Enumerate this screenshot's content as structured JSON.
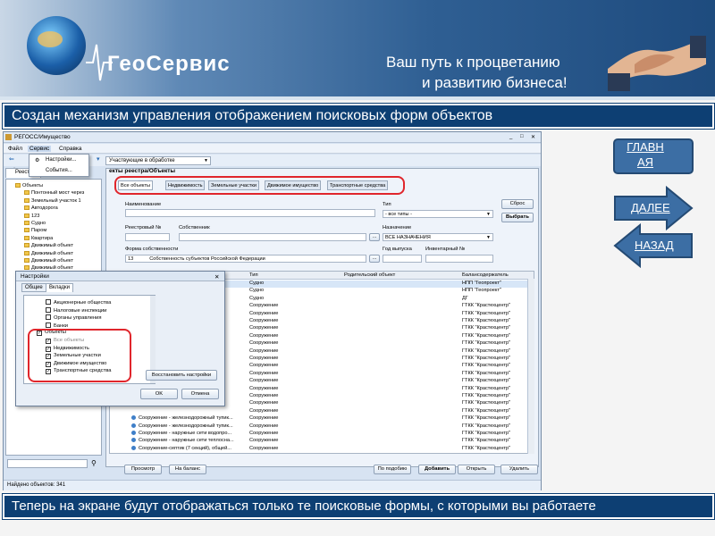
{
  "banner": {
    "logo": "ГеоСервис",
    "slogan_line1": "Ваш путь к процветанию",
    "slogan_line2": "и развитию бизнеса!"
  },
  "top_caption": "Создан механизм управления отображением поисковых форм объектов",
  "bottom_caption": "Теперь на экране будут отображаться только те поисковые формы, с которыми вы работаете",
  "nav": {
    "home": "ГЛАВНАЯ",
    "next": "ДАЛЕЕ",
    "back": "НАЗАД"
  },
  "colors": {
    "caption_bg": "#0d3f73",
    "nav_blue": "#3c6ea4",
    "highlight_red": "#e0262c"
  },
  "window": {
    "title": "РЕГОСС/Имущество",
    "menu": [
      "Файл",
      "Сервис",
      "Справка"
    ],
    "toolbar_combo": "Участвующие в обработке",
    "service_menu": [
      "Настройки...",
      "События..."
    ],
    "registry_tab": "Реестр",
    "registry_title": "екты реестра/Объекты",
    "tree": [
      "Объекты",
      "Понтонный мост через",
      "Земельный участок 1",
      "Автодорога",
      "123",
      "Судно",
      "Паром",
      "Квартира",
      "Движимый объект",
      "Движимый объект",
      "Движимый объект",
      "Движимый объект",
      "Движимый объект",
      "Движимый объект"
    ],
    "search_tabs": [
      "Все объекты",
      "Недвижимость",
      "Земельные участки",
      "Движимое имущество",
      "Транспортные средства"
    ],
    "form": {
      "name_label": "Наименование",
      "type_label": "Тип",
      "type_value": "- все типы -",
      "reg_label": "Реестровый №",
      "owner_label": "Собственник",
      "purpose_label": "Назначение",
      "purpose_value": "ВСЕ НАЗНАЧЕНИЯ",
      "ownership_label": "Форма собственности",
      "ownership_code": "13",
      "ownership_value": "Собственность субъектов Российской Федерации",
      "year_label": "Год выпуска",
      "inv_label": "Инвентарный №",
      "reset_button": "Сброс",
      "select_button": "Выбрать"
    },
    "grid": {
      "headers": [
        "Тип",
        "Родительский объект",
        "Балансодержатель"
      ],
      "rows": [
        {
          "name": "",
          "type": "Судно",
          "holder": "НПП \"Геопроект\""
        },
        {
          "name": "",
          "type": "Судно",
          "holder": "НПП \"Геопроект\""
        },
        {
          "name": "",
          "type": "Судно",
          "holder": "ДГ"
        },
        {
          "name": "",
          "type": "Сооружение",
          "holder": "ГТКК \"Крастехцентр\""
        },
        {
          "name": "",
          "type": "Сооружение",
          "holder": "ГТКК \"Крастехцентр\""
        },
        {
          "name": "",
          "type": "Сооружение",
          "holder": "ГТКК \"Крастехцентр\""
        },
        {
          "name": "",
          "type": "Сооружение",
          "holder": "ГТКК \"Крастехцентр\""
        },
        {
          "name": "",
          "type": "Сооружение",
          "holder": "ГТКК \"Крастехцентр\""
        },
        {
          "name": "",
          "type": "Сооружение",
          "holder": "ГТКК \"Крастехцентр\""
        },
        {
          "name": "",
          "type": "Сооружение",
          "holder": "ГТКК \"Крастехцентр\""
        },
        {
          "name": "",
          "type": "Сооружение",
          "holder": "ГТКК \"Крастехцентр\""
        },
        {
          "name": "",
          "type": "Сооружение",
          "holder": "ГТКК \"Крастехцентр\""
        },
        {
          "name": "",
          "type": "Сооружение",
          "holder": "ГТКК \"Крастехцентр\""
        },
        {
          "name": "",
          "type": "Сооружение",
          "holder": "ГТКК \"Крастехцентр\""
        },
        {
          "name": "",
          "type": "Сооружение",
          "holder": "ГТКК \"Крастехцентр\""
        },
        {
          "name": "",
          "type": "Сооружение",
          "holder": "ГТКК \"Крастехцентр\""
        },
        {
          "name": "",
          "type": "Сооружение",
          "holder": "ГТКК \"Крастехцентр\""
        },
        {
          "name": "",
          "type": "Сооружение",
          "holder": "ГТКК \"Крастехцентр\""
        },
        {
          "name": "Сооружение - железнодорожный тупик...",
          "type": "Сооружение",
          "holder": "ГТКК \"Крастехцентр\""
        },
        {
          "name": "Сооружение - железнодорожный тупик...",
          "type": "Сооружение",
          "holder": "ГТКК \"Крастехцентр\""
        },
        {
          "name": "Сооружение - наружные сети водопро...",
          "type": "Сооружение",
          "holder": "ГТКК \"Крастехцентр\""
        },
        {
          "name": "Сооружение - наружные сети теплосна...",
          "type": "Сооружение",
          "holder": "ГТКК \"Крастехцентр\""
        },
        {
          "name": "Сооружение-септик (7 секций), общей...",
          "type": "Сооружение",
          "holder": "ГТКК \"Крастехцентр\""
        }
      ]
    },
    "bottom_buttons": [
      "Просмотр",
      "На баланс",
      "По подобию",
      "Добавить",
      "Открыть",
      "Удалить"
    ],
    "status": "Найдено объектов: 341"
  },
  "dialog": {
    "title": "Настройки",
    "tabs": [
      "Общие",
      "Вкладки"
    ],
    "items": [
      {
        "label": "Акционерные общества",
        "checked": false
      },
      {
        "label": "Налоговые инспекции",
        "checked": false
      },
      {
        "label": "Органы управления",
        "checked": false
      },
      {
        "label": "Банки",
        "checked": false
      },
      {
        "label": "Объекты",
        "checked": true
      },
      {
        "label": "Все объекты",
        "checked": true
      },
      {
        "label": "Недвижимость",
        "checked": true
      },
      {
        "label": "Земельные участки",
        "checked": true
      },
      {
        "label": "Движимое имущество",
        "checked": true
      },
      {
        "label": "Транспортные средства",
        "checked": true
      }
    ],
    "restore_button": "Восстановить настройки",
    "ok_button": "OK",
    "cancel_button": "Отмена"
  }
}
